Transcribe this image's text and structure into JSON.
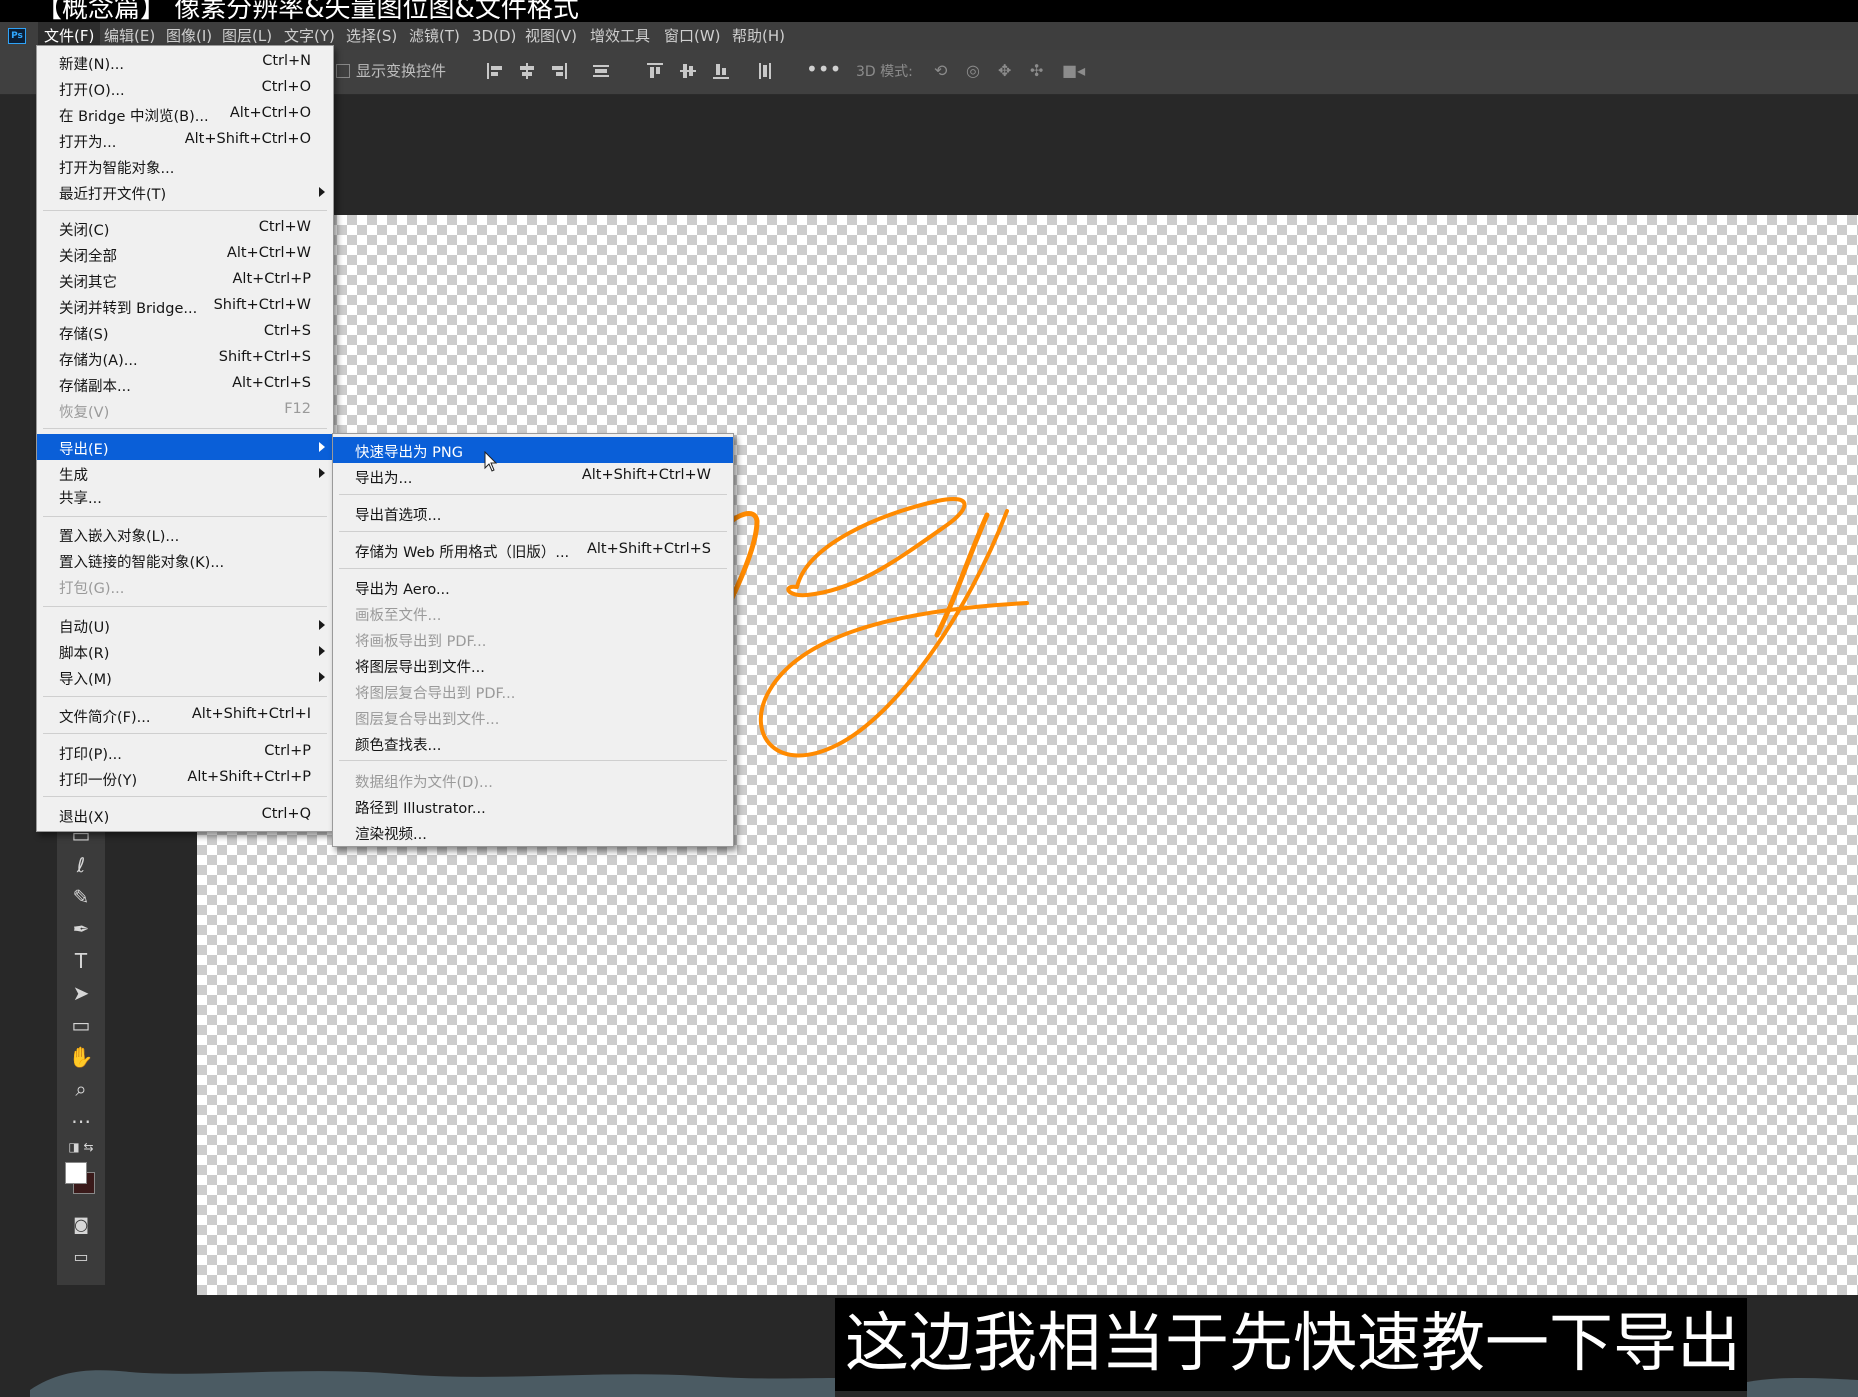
{
  "video": {
    "title": "【概念篇】 像素分辨率&矢量图位图&文件格式",
    "subtitle": "这边我相当于先快速教一下导出"
  },
  "app": {
    "logo": "Ps",
    "accent": "#0a5fd8",
    "stroke_color": "#ff8a00"
  },
  "menubar": {
    "items": [
      {
        "label": "文件(F)"
      },
      {
        "label": "编辑(E)"
      },
      {
        "label": "图像(I)"
      },
      {
        "label": "图层(L)"
      },
      {
        "label": "文字(Y)"
      },
      {
        "label": "选择(S)"
      },
      {
        "label": "滤镜(T)"
      },
      {
        "label": "3D(D)"
      },
      {
        "label": "视图(V)"
      },
      {
        "label": "增效工具"
      },
      {
        "label": "窗口(W)"
      },
      {
        "label": "帮助(H)"
      }
    ]
  },
  "options_bar": {
    "show_transform_controls": "显示变换控件",
    "mode_3d": "3D 模式:",
    "icons": [
      "align-left-icon",
      "align-hcenter-icon",
      "align-right-icon",
      "distribute-icon",
      "align-top-icon",
      "align-vcenter-icon",
      "align-bottom-icon",
      "distribute-v-icon",
      "more-icon",
      "orbit-icon",
      "roll-icon",
      "pan-icon",
      "slide-icon",
      "camera-icon"
    ]
  },
  "file_menu": {
    "items": [
      {
        "label": "新建(N)...",
        "shortcut": "Ctrl+N"
      },
      {
        "label": "打开(O)...",
        "shortcut": "Ctrl+O"
      },
      {
        "label": "在 Bridge 中浏览(B)...",
        "shortcut": "Alt+Ctrl+O"
      },
      {
        "label": "打开为...",
        "shortcut": "Alt+Shift+Ctrl+O"
      },
      {
        "label": "打开为智能对象...",
        "shortcut": ""
      },
      {
        "label": "最近打开文件(T)",
        "shortcut": "",
        "submenu": true
      },
      {
        "separator": true
      },
      {
        "label": "关闭(C)",
        "shortcut": "Ctrl+W"
      },
      {
        "label": "关闭全部",
        "shortcut": "Alt+Ctrl+W"
      },
      {
        "label": "关闭其它",
        "shortcut": "Alt+Ctrl+P"
      },
      {
        "label": "关闭并转到 Bridge...",
        "shortcut": "Shift+Ctrl+W"
      },
      {
        "label": "存储(S)",
        "shortcut": "Ctrl+S"
      },
      {
        "label": "存储为(A)...",
        "shortcut": "Shift+Ctrl+S"
      },
      {
        "label": "存储副本...",
        "shortcut": "Alt+Ctrl+S"
      },
      {
        "label": "恢复(V)",
        "shortcut": "F12",
        "disabled": true
      },
      {
        "separator": true
      },
      {
        "label": "导出(E)",
        "shortcut": "",
        "submenu": true,
        "highlighted": true
      },
      {
        "label": "生成",
        "shortcut": "",
        "submenu": true
      },
      {
        "label": "共享...",
        "shortcut": ""
      },
      {
        "separator": true
      },
      {
        "label": "置入嵌入对象(L)...",
        "shortcut": ""
      },
      {
        "label": "置入链接的智能对象(K)...",
        "shortcut": ""
      },
      {
        "label": "打包(G)...",
        "shortcut": "",
        "disabled": true
      },
      {
        "separator": true
      },
      {
        "label": "自动(U)",
        "shortcut": "",
        "submenu": true
      },
      {
        "label": "脚本(R)",
        "shortcut": "",
        "submenu": true
      },
      {
        "label": "导入(M)",
        "shortcut": "",
        "submenu": true
      },
      {
        "separator": true
      },
      {
        "label": "文件简介(F)...",
        "shortcut": "Alt+Shift+Ctrl+I"
      },
      {
        "separator": true
      },
      {
        "label": "打印(P)...",
        "shortcut": "Ctrl+P"
      },
      {
        "label": "打印一份(Y)",
        "shortcut": "Alt+Shift+Ctrl+P"
      },
      {
        "separator": true
      },
      {
        "label": "退出(X)",
        "shortcut": "Ctrl+Q"
      }
    ]
  },
  "export_submenu": {
    "items": [
      {
        "label": "快速导出为 PNG",
        "shortcut": "",
        "highlighted": true
      },
      {
        "label": "导出为...",
        "shortcut": "Alt+Shift+Ctrl+W"
      },
      {
        "separator": true
      },
      {
        "label": "导出首选项...",
        "shortcut": ""
      },
      {
        "separator": true
      },
      {
        "label": "存储为 Web 所用格式（旧版）...",
        "shortcut": "Alt+Shift+Ctrl+S"
      },
      {
        "separator": true
      },
      {
        "label": "导出为 Aero...",
        "shortcut": ""
      },
      {
        "label": "画板至文件...",
        "shortcut": "",
        "disabled": true
      },
      {
        "label": "将画板导出到 PDF...",
        "shortcut": "",
        "disabled": true
      },
      {
        "label": "将图层导出到文件...",
        "shortcut": ""
      },
      {
        "label": "将图层复合导出到 PDF...",
        "shortcut": "",
        "disabled": true
      },
      {
        "label": "图层复合导出到文件...",
        "shortcut": "",
        "disabled": true
      },
      {
        "label": "颜色查找表...",
        "shortcut": ""
      },
      {
        "separator": true
      },
      {
        "label": "数据组作为文件(D)...",
        "shortcut": "",
        "disabled": true
      },
      {
        "label": "路径到 Illustrator...",
        "shortcut": ""
      },
      {
        "label": "渲染视频...",
        "shortcut": ""
      }
    ]
  },
  "toolbar": {
    "tools": [
      "lasso-icon",
      "quick-select-icon",
      "pen-icon",
      "type-icon",
      "path-select-icon",
      "rectangle-icon",
      "hand-icon",
      "zoom-icon",
      "more-tools-icon",
      "default-colors-icon",
      "foreground-background-icon",
      "quick-mask-icon",
      "screen-mode-icon"
    ]
  }
}
